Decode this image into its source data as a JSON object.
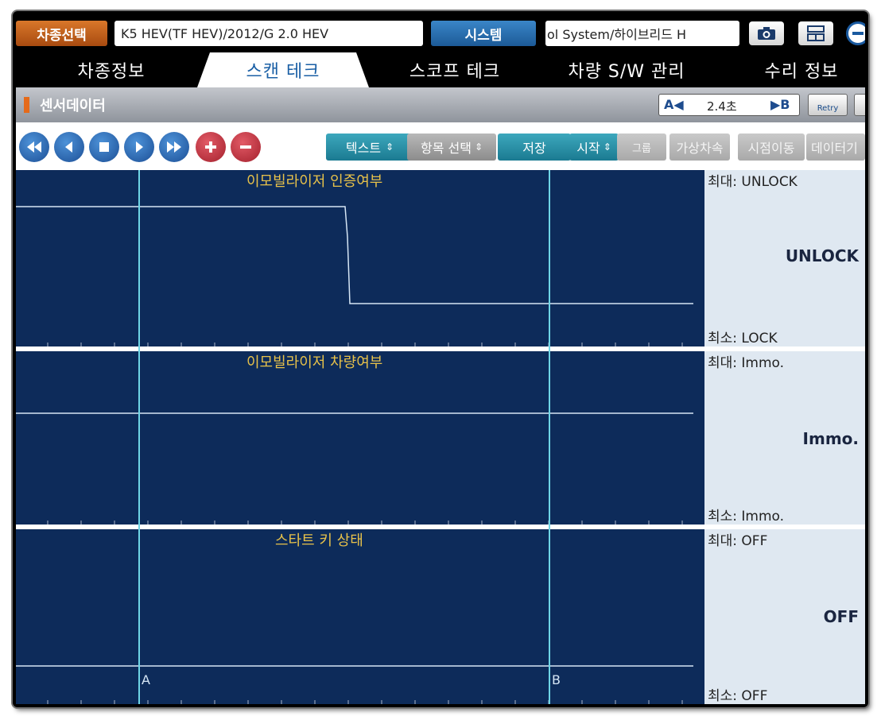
{
  "topbar": {
    "model_select_label": "차종선택",
    "model_value": "K5 HEV(TF HEV)/2012/G 2.0 HEV",
    "system_label": "시스템",
    "system_value": "ol System/하이브리드    H"
  },
  "tabs": [
    {
      "label": "차종정보"
    },
    {
      "label": "스캔 테크"
    },
    {
      "label": "스코프 테크"
    },
    {
      "label": "차량 S/W 관리"
    },
    {
      "label": "수리 정보"
    }
  ],
  "titlebar": {
    "title": "센서데이터",
    "cursor_a": "A◀",
    "cursor_interval": "2.4초",
    "cursor_b": "▶B",
    "retry_label": "Retry"
  },
  "toolbar": {
    "text_label": "텍스트",
    "item_select_label": "항목 선택",
    "save_label": "저장",
    "start_label": "시작",
    "group_label": "그룹",
    "virtual_speed_label": "가상차속",
    "time_move_label": "시점이동",
    "data_label": "데이터기"
  },
  "panels": [
    {
      "title": "이모빌라이저 인증여부",
      "max": "최대: UNLOCK",
      "min": "최소: LOCK",
      "current": "UNLOCK"
    },
    {
      "title": "이모빌라이저 차량여부",
      "max": "최대: Immo.",
      "min": "최소: Immo.",
      "current": "Immo."
    },
    {
      "title": "스타트 키 상태",
      "max": "최대: OFF",
      "min": "최소: OFF",
      "current": "OFF"
    }
  ],
  "markers": {
    "a": "A",
    "b": "B"
  },
  "colors": {
    "plot_bg": "#0d2b5a",
    "signal": "#d6e6f5",
    "cursor_line": "#6fd6e6",
    "title_text": "#e8c24a"
  }
}
